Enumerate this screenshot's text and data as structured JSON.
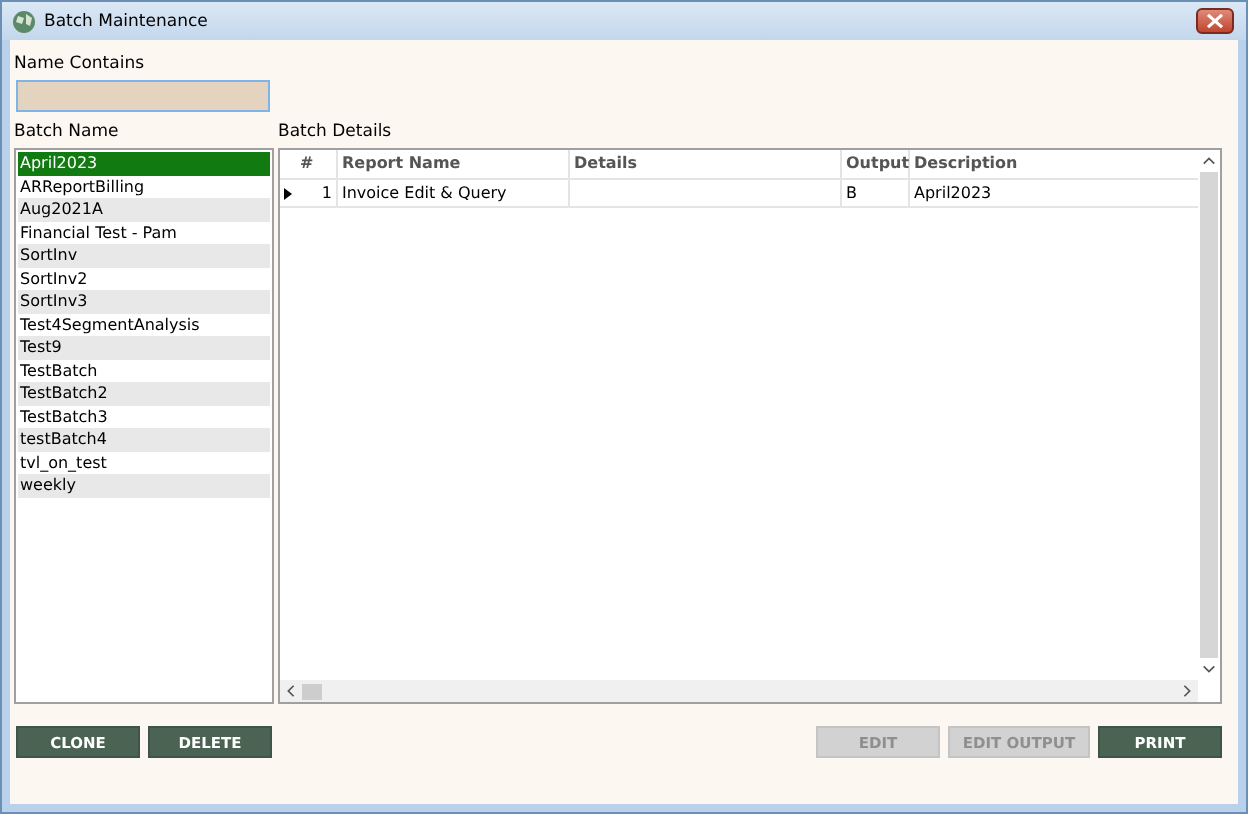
{
  "window": {
    "title": "Batch Maintenance"
  },
  "filter": {
    "label": "Name Contains"
  },
  "batch_list": {
    "label": "Batch Name",
    "items": [
      {
        "name": "April2023",
        "selected": true
      },
      {
        "name": "ARReportBilling",
        "selected": false
      },
      {
        "name": "Aug2021A",
        "selected": false
      },
      {
        "name": "Financial Test - Pam",
        "selected": false
      },
      {
        "name": "SortInv",
        "selected": false
      },
      {
        "name": "SortInv2",
        "selected": false
      },
      {
        "name": "SortInv3",
        "selected": false
      },
      {
        "name": "Test4SegmentAnalysis",
        "selected": false
      },
      {
        "name": "Test9",
        "selected": false
      },
      {
        "name": "TestBatch",
        "selected": false
      },
      {
        "name": "TestBatch2",
        "selected": false
      },
      {
        "name": "TestBatch3",
        "selected": false
      },
      {
        "name": "testBatch4",
        "selected": false
      },
      {
        "name": "tvl_on_test",
        "selected": false
      },
      {
        "name": "weekly",
        "selected": false
      }
    ]
  },
  "details": {
    "label": "Batch Details",
    "columns": [
      "#",
      "Report Name",
      "Details",
      "Output",
      "Description"
    ],
    "rows": [
      {
        "current": true,
        "cells": [
          "1",
          "Invoice Edit & Query",
          "",
          "B",
          "April2023"
        ]
      }
    ]
  },
  "left_buttons": [
    {
      "label": "CLONE",
      "disabled": false
    },
    {
      "label": "DELETE",
      "disabled": false
    }
  ],
  "right_buttons": [
    {
      "label": "EDIT",
      "disabled": true
    },
    {
      "label": "EDIT OUTPUT",
      "disabled": true
    },
    {
      "label": "PRINT",
      "disabled": false
    }
  ]
}
